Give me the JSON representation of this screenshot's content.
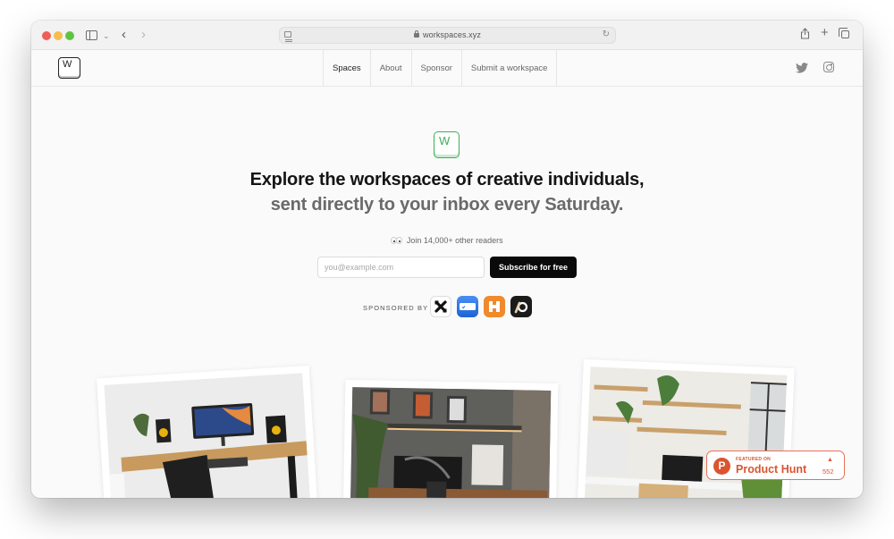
{
  "browser": {
    "url": "workspaces.xyz",
    "icons": [
      "sidebar-toggle-icon",
      "chevron-down-icon",
      "back-icon",
      "forward-icon",
      "reader-icon",
      "lock-icon",
      "reload-icon",
      "share-icon",
      "new-tab-icon",
      "tab-overview-icon"
    ],
    "glyphs": {
      "chevron": "⌄",
      "back": "‹",
      "forward": "›",
      "reload": "↻",
      "share": "⇧",
      "new_tab": "+"
    }
  },
  "header": {
    "logo_letter": "W",
    "nav": [
      {
        "label": "Spaces",
        "active": true
      },
      {
        "label": "About",
        "active": false
      },
      {
        "label": "Sponsor",
        "active": false
      },
      {
        "label": "Submit a workspace",
        "active": false
      }
    ],
    "social": [
      "twitter-icon",
      "instagram-icon"
    ]
  },
  "hero": {
    "logo_letter": "W",
    "headline": "Explore the workspaces of creative individuals,",
    "subheadline": "sent directly to your inbox every Saturday.",
    "readers_text": "Join 14,000+ other readers",
    "email_placeholder": "you@example.com",
    "email_value": "",
    "subscribe_label": "Subscribe for free",
    "sponsored_label": "SPONSORED BY",
    "sponsors": [
      {
        "name": "sponsor-x-logo",
        "color": "#ffffff"
      },
      {
        "name": "sponsor-blue-logo",
        "color": "#2a72e6"
      },
      {
        "name": "sponsor-orange-logo",
        "color": "#f08a2c"
      },
      {
        "name": "sponsor-dark-logo",
        "color": "#1b1b1b"
      }
    ]
  },
  "gallery": [
    {
      "name": "workspace-photo-white-desk"
    },
    {
      "name": "workspace-photo-dark-wall"
    },
    {
      "name": "workspace-photo-plant-shelves"
    }
  ],
  "product_hunt": {
    "featured_label": "FEATURED ON",
    "name": "Product Hunt",
    "arrow": "▲",
    "count": "552",
    "logo_letter": "P",
    "color": "#da552f"
  },
  "colors": {
    "accent_green": "#3fae57",
    "button_black": "#0a0a0a",
    "product_hunt": "#da552f"
  }
}
